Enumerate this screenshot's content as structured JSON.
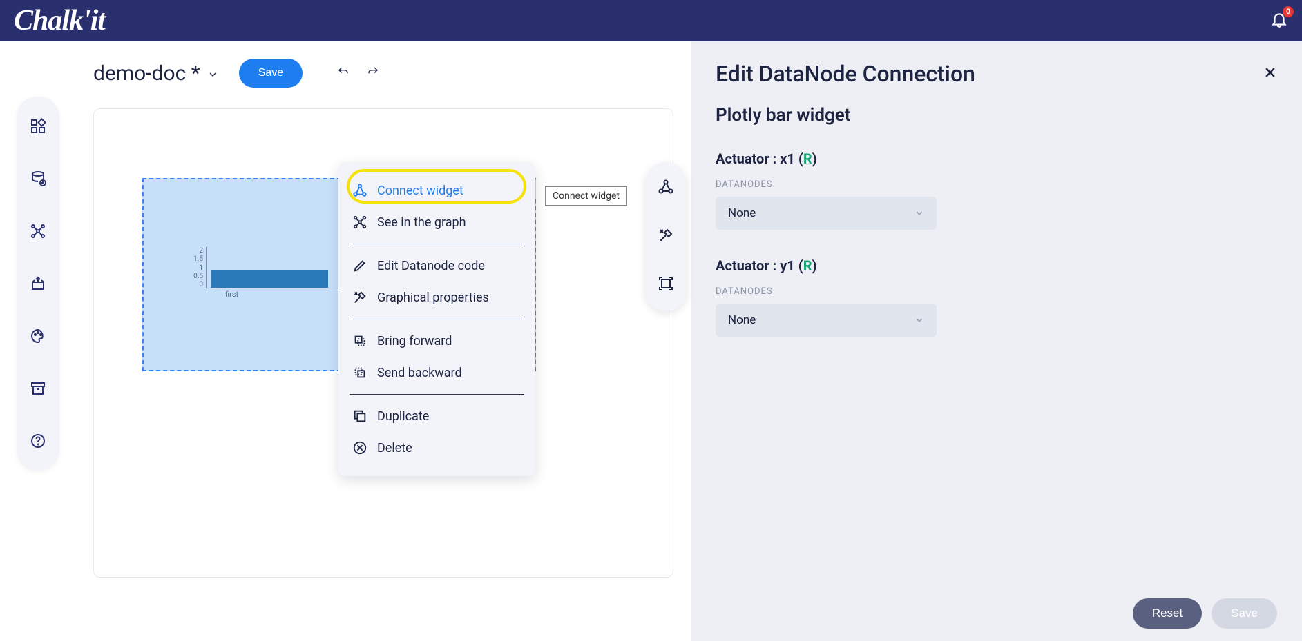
{
  "header": {
    "logo_text": "Chalk'it",
    "notification_count": "0"
  },
  "document": {
    "title": "demo-doc *",
    "save_label": "Save"
  },
  "context_menu": {
    "connect_widget": "Connect widget",
    "see_in_graph": "See in the graph",
    "edit_datanode_code": "Edit Datanode code",
    "graphical_properties": "Graphical properties",
    "bring_forward": "Bring forward",
    "send_backward": "Send backward",
    "duplicate": "Duplicate",
    "delete": "Delete"
  },
  "tooltip": {
    "connect_widget_tip": "Connect widget"
  },
  "panel": {
    "title": "Edit DataNode Connection",
    "widget_name": "Plotly bar widget",
    "actuators": [
      {
        "label_prefix": "Actuator : ",
        "name": "x1",
        "tag": "R",
        "datanodes_label": "DATANODES",
        "selected": "None"
      },
      {
        "label_prefix": "Actuator : ",
        "name": "y1",
        "tag": "R",
        "datanodes_label": "DATANODES",
        "selected": "None"
      }
    ],
    "reset_label": "Reset",
    "save_label": "Save"
  },
  "chart_data": {
    "type": "bar",
    "categories": [
      "first"
    ],
    "values": [
      1
    ],
    "title": "",
    "xlabel": "",
    "ylabel": "",
    "yticks": [
      "2",
      "1.5",
      "1",
      "0.5",
      "0"
    ],
    "ylim": [
      0,
      2
    ]
  }
}
